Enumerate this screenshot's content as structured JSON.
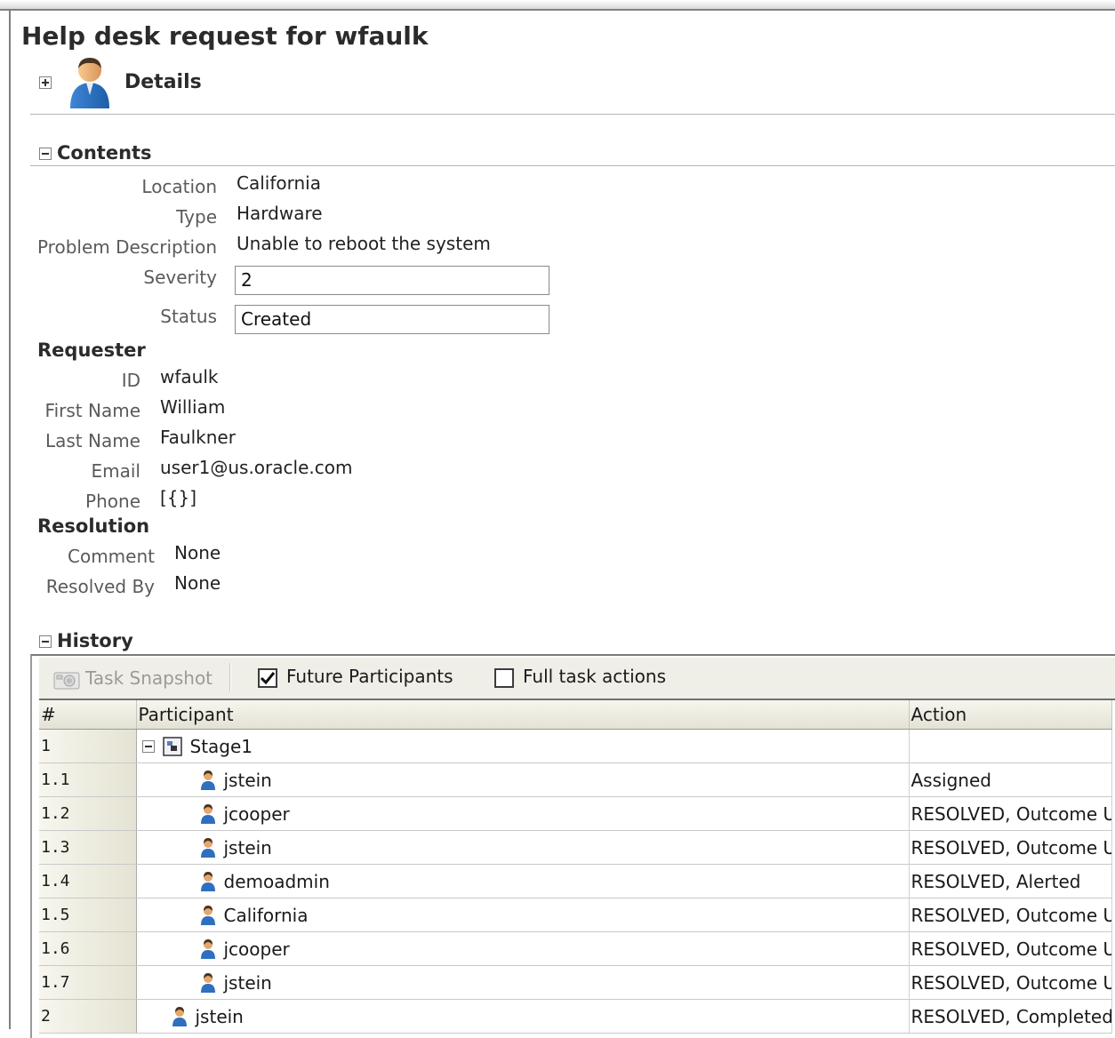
{
  "page": {
    "title": "Help desk request for wfaulk"
  },
  "details": {
    "label": "Details"
  },
  "contents": {
    "title": "Contents",
    "fields": {
      "location": {
        "label": "Location",
        "value": "California"
      },
      "type": {
        "label": "Type",
        "value": "Hardware"
      },
      "problem": {
        "label": "Problem Description",
        "value": "Unable to reboot the system"
      },
      "severity": {
        "label": "Severity",
        "value": "2"
      },
      "status": {
        "label": "Status",
        "value": "Created"
      }
    },
    "requester": {
      "title": "Requester",
      "id": {
        "label": "ID",
        "value": "wfaulk"
      },
      "first_name": {
        "label": "First Name",
        "value": "William"
      },
      "last_name": {
        "label": "Last Name",
        "value": "Faulkner"
      },
      "email": {
        "label": "Email",
        "value": "user1@us.oracle.com"
      },
      "phone": {
        "label": "Phone",
        "value": "[{}]"
      }
    },
    "resolution": {
      "title": "Resolution",
      "comment": {
        "label": "Comment",
        "value": "None"
      },
      "resolved_by": {
        "label": "Resolved By",
        "value": "None"
      }
    }
  },
  "history": {
    "title": "History",
    "toolbar": {
      "snapshot_label": "Task Snapshot",
      "future_participants_label": "Future Participants",
      "future_participants_checked": true,
      "full_task_actions_label": "Full task actions",
      "full_task_actions_checked": false
    },
    "columns": {
      "num": "#",
      "participant": "Participant",
      "action": "Action"
    },
    "rows": [
      {
        "num": "1",
        "participant": "Stage1",
        "action": ""
      },
      {
        "num": "1.1",
        "participant": "jstein",
        "action": "Assigned"
      },
      {
        "num": "1.2",
        "participant": "jcooper",
        "action": "RESOLVED, Outcome Up"
      },
      {
        "num": "1.3",
        "participant": "jstein",
        "action": "RESOLVED, Outcome Up"
      },
      {
        "num": "1.4",
        "participant": "demoadmin",
        "action": "RESOLVED, Alerted"
      },
      {
        "num": "1.5",
        "participant": "California",
        "action": "RESOLVED, Outcome Up"
      },
      {
        "num": "1.6",
        "participant": "jcooper",
        "action": "RESOLVED, Outcome Up"
      },
      {
        "num": "1.7",
        "participant": "jstein",
        "action": "RESOLVED, Outcome Up"
      },
      {
        "num": "2",
        "participant": "jstein",
        "action": "RESOLVED, Completed"
      }
    ]
  }
}
